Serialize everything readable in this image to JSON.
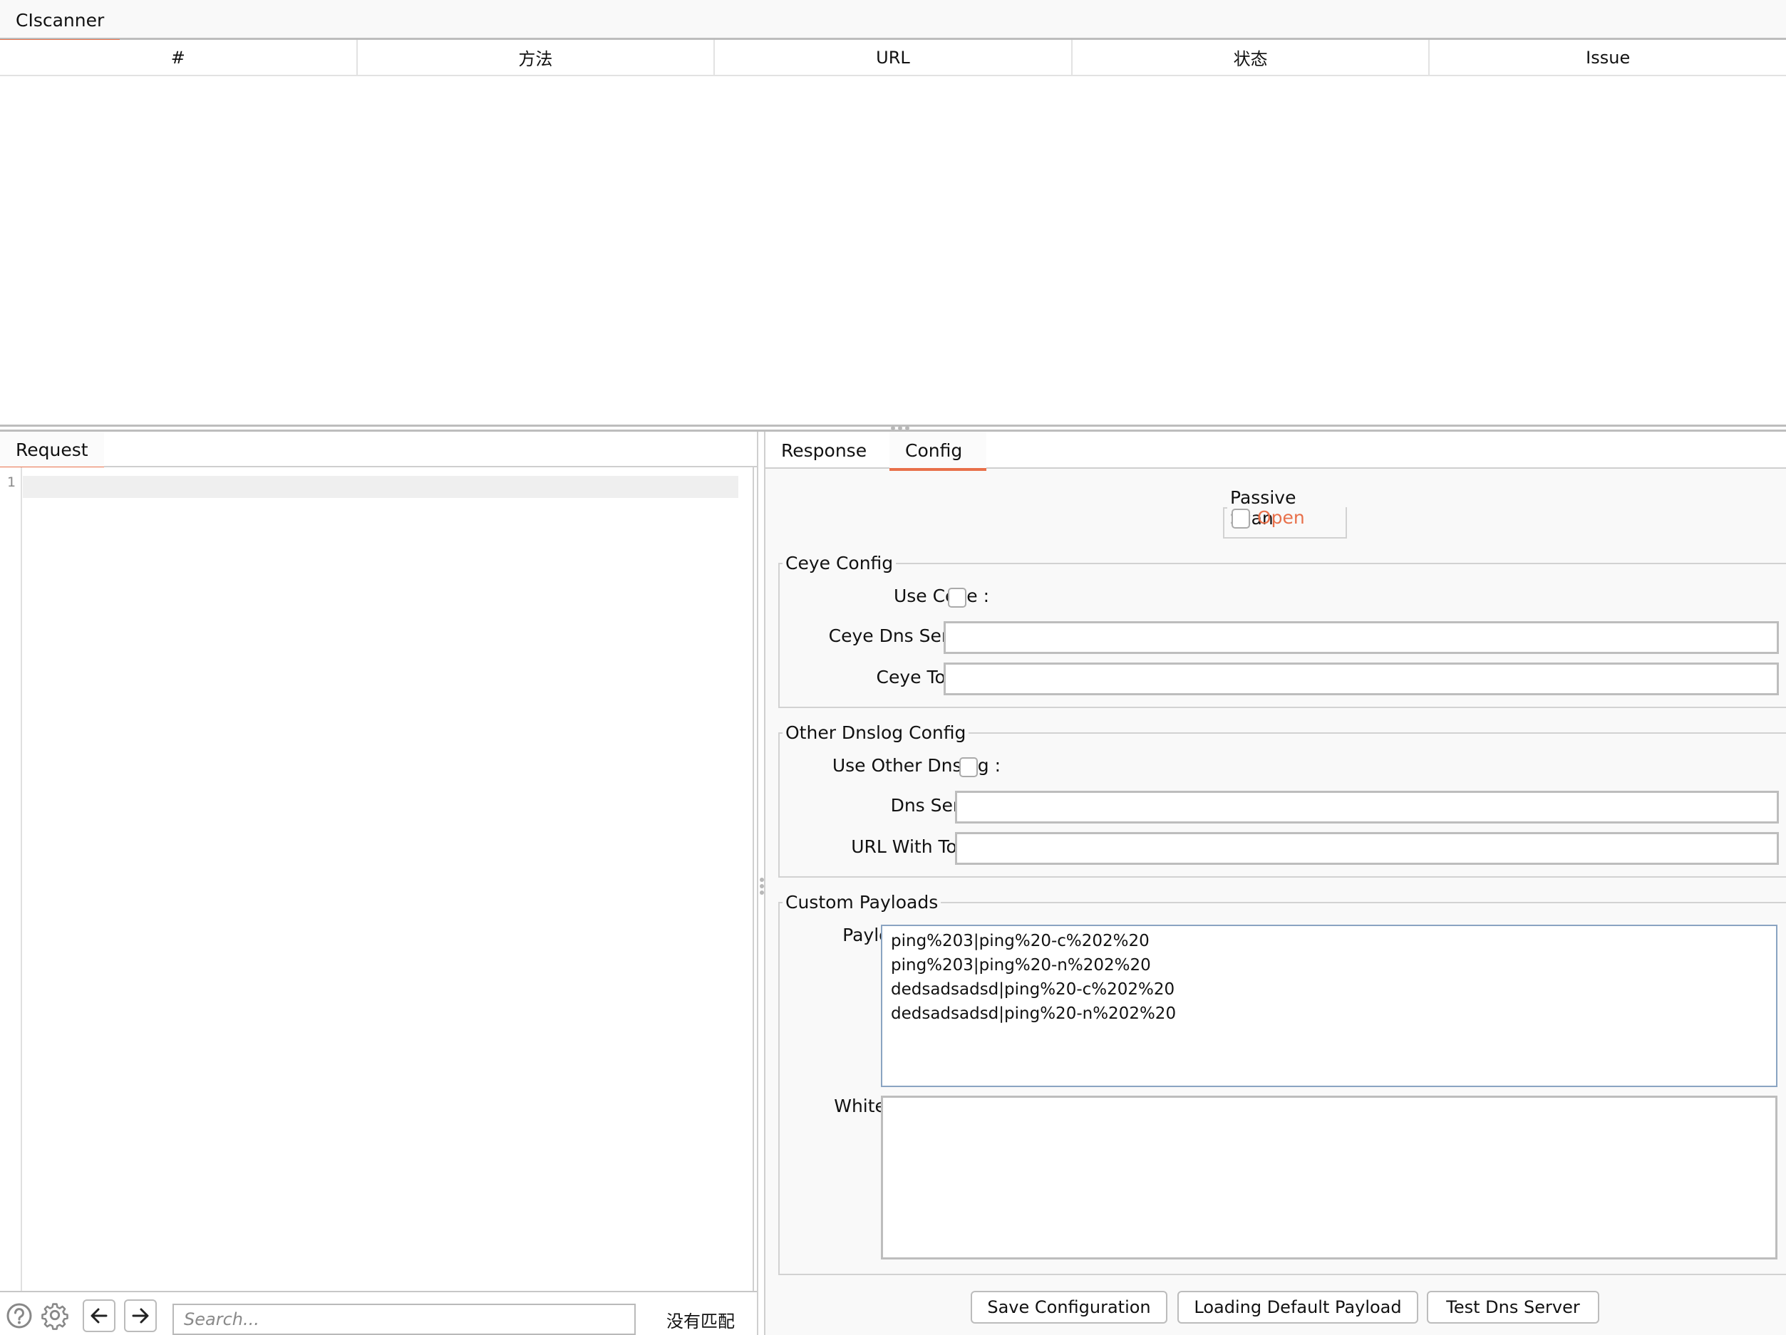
{
  "app": {
    "tabs": [
      {
        "label": "CIscanner",
        "active": true
      }
    ]
  },
  "results_table": {
    "columns": [
      "#",
      "方法",
      "URL",
      "状态",
      "Issue"
    ],
    "rows": []
  },
  "request_pane": {
    "tabs": [
      {
        "label": "Request",
        "active": true
      }
    ],
    "editor": {
      "line_numbers": [
        "1"
      ],
      "content": ""
    },
    "toolbar": {
      "help_icon": "help-circle-icon",
      "settings_icon": "gear-icon",
      "back_icon": "arrow-left-icon",
      "forward_icon": "arrow-right-icon",
      "search_placeholder": "Search...",
      "search_value": "",
      "match_status": "没有匹配"
    }
  },
  "right_pane": {
    "tabs": [
      {
        "label": "Response",
        "active": false
      },
      {
        "label": "Config",
        "active": true
      }
    ],
    "config": {
      "passive_scan": {
        "title": "Passive Scan",
        "checkbox_label": "Open",
        "checked": false
      },
      "ceye_config": {
        "title": "Ceye Config",
        "use_label": "Use Ceye :",
        "use_checked": false,
        "dns_server_label": "Ceye Dns Server :",
        "dns_server_value": "",
        "token_label": "Ceye Token :",
        "token_value": ""
      },
      "other_dnslog_config": {
        "title": "Other Dnslog Config",
        "use_label": "Use Other Dnslog :",
        "use_checked": false,
        "dns_server_label": "Dns Server :",
        "dns_server_value": "",
        "url_token_label": "URL With Token :",
        "url_token_value": ""
      },
      "custom_payloads": {
        "title": "Custom Payloads",
        "payload_label": "Payload :",
        "payload_value": "ping%203|ping%20-c%202%20\nping%203|ping%20-n%202%20\ndedsadsadsd|ping%20-c%202%20\ndedsadsadsd|ping%20-n%202%20",
        "whitelist_label": "Whitelist :",
        "whitelist_value": ""
      },
      "buttons": {
        "save": "Save Configuration",
        "load_default": "Loading Default Payload",
        "test_dns": "Test Dns Server"
      }
    }
  },
  "colors": {
    "accent": "#e8704a",
    "panel_bg": "#f9f9f9",
    "border": "#bdbdbd"
  }
}
